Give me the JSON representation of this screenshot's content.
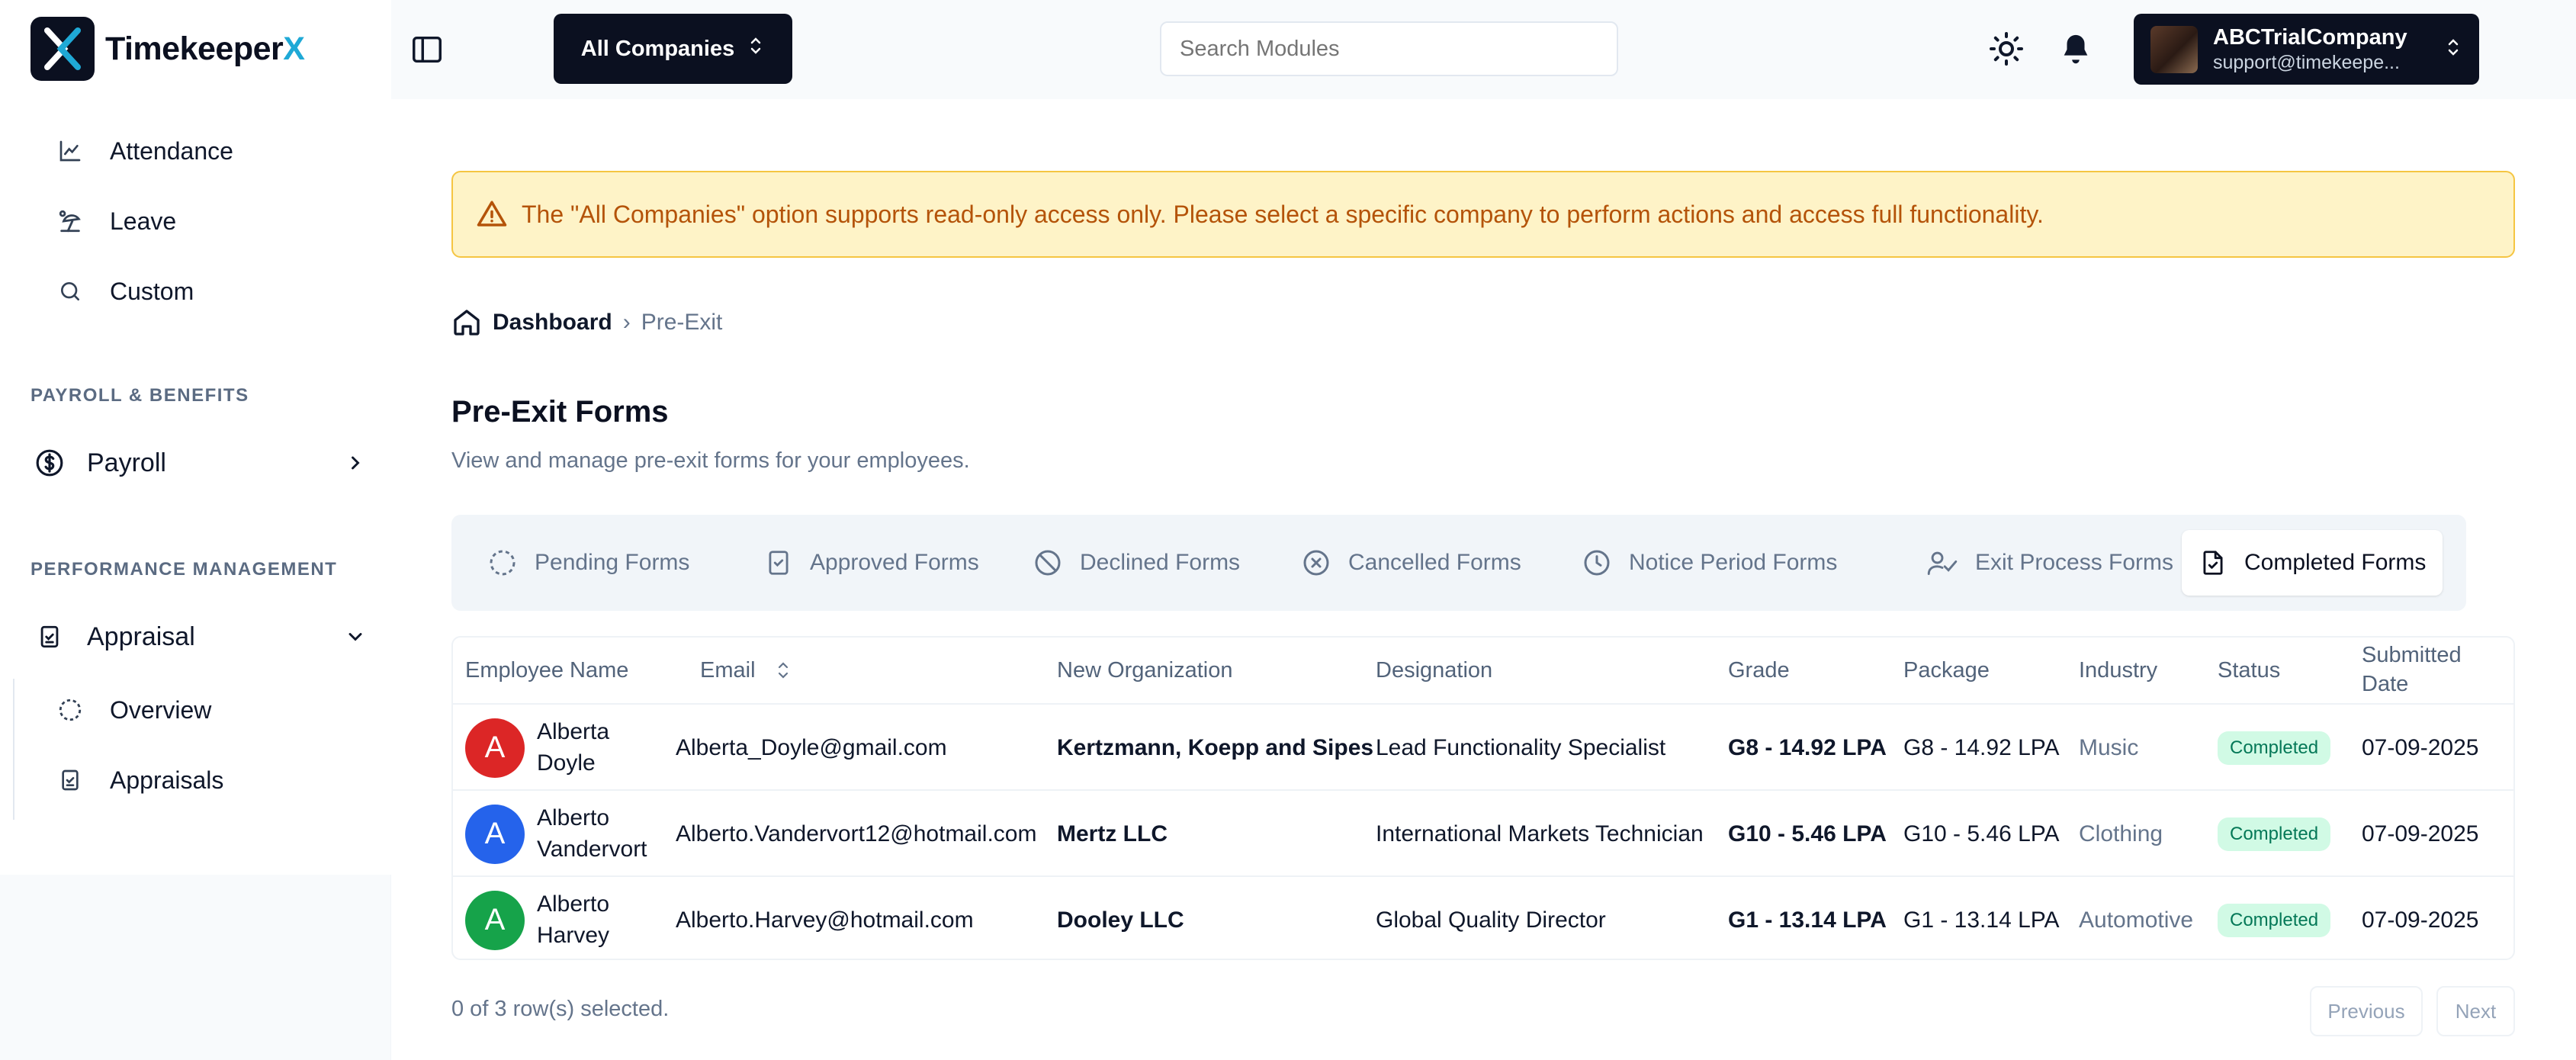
{
  "app": {
    "name_main": "Timekeeper",
    "name_accent": "X",
    "accent_color": "#1fa9d6"
  },
  "sidebar": {
    "items_top": [
      {
        "label": "Attendance",
        "icon": "line-chart-icon"
      },
      {
        "label": "Leave",
        "icon": "beach-umbrella-icon"
      },
      {
        "label": "Custom",
        "icon": "search-icon"
      }
    ],
    "section_payroll": "PAYROLL & BENEFITS",
    "payroll": {
      "label": "Payroll",
      "icon": "dollar-circle-icon"
    },
    "section_performance": "PERFORMANCE MANAGEMENT",
    "appraisal": {
      "label": "Appraisal",
      "icon": "clipboard-check-icon"
    },
    "appraisal_children": [
      {
        "label": "Overview",
        "icon": "dashed-circle-icon"
      },
      {
        "label": "Appraisals",
        "icon": "clipboard-check-icon"
      }
    ]
  },
  "topbar": {
    "company_selector": "All Companies",
    "search_placeholder": "Search Modules",
    "account_name": "ABCTrialCompany",
    "account_email": "support@timekeepe..."
  },
  "alert": {
    "text": "The \"All Companies\" option supports read-only access only. Please select a specific company to perform actions and access full functionality."
  },
  "breadcrumb": {
    "home": "Dashboard",
    "current": "Pre-Exit"
  },
  "page": {
    "title": "Pre-Exit Forms",
    "subtitle": "View and manage pre-exit forms for your employees."
  },
  "tabs": [
    {
      "label": "Pending Forms",
      "icon": "dashed-circle-icon"
    },
    {
      "label": "Approved Forms",
      "icon": "clipboard-check-icon"
    },
    {
      "label": "Declined Forms",
      "icon": "ban-icon"
    },
    {
      "label": "Cancelled Forms",
      "icon": "x-circle-icon"
    },
    {
      "label": "Notice Period Forms",
      "icon": "clock-icon"
    },
    {
      "label": "Exit Process Forms",
      "icon": "user-check-icon"
    },
    {
      "label": "Completed Forms",
      "icon": "file-check-icon",
      "active": true
    }
  ],
  "table": {
    "headers": {
      "name": "Employee Name",
      "email": "Email",
      "org": "New Organization",
      "designation": "Designation",
      "grade": "Grade",
      "package": "Package",
      "industry": "Industry",
      "status": "Status",
      "date_line1": "Submitted",
      "date_line2": "Date"
    },
    "rows": [
      {
        "initial": "A",
        "avatar_color": "#dc2626",
        "first": "Alberta",
        "last": "Doyle",
        "email": "Alberta_Doyle@gmail.com",
        "org": "Kertzmann, Koepp and Sipes",
        "designation": "Lead Functionality Specialist",
        "grade": "G8 - 14.92 LPA",
        "package": "G8 - 14.92 LPA",
        "industry": "Music",
        "status": "Completed",
        "date": "07-09-2025"
      },
      {
        "initial": "A",
        "avatar_color": "#2563eb",
        "first": "Alberto",
        "last": "Vandervort",
        "email": "Alberto.Vandervort12@hotmail.com",
        "org": "Mertz LLC",
        "designation": "International Markets Technician",
        "grade": "G10 - 5.46 LPA",
        "package": "G10 - 5.46 LPA",
        "industry": "Clothing",
        "status": "Completed",
        "date": "07-09-2025"
      },
      {
        "initial": "A",
        "avatar_color": "#16a34a",
        "first": "Alberto",
        "last": "Harvey",
        "email": "Alberto.Harvey@hotmail.com",
        "org": "Dooley LLC",
        "designation": "Global Quality Director",
        "grade": "G1 - 13.14 LPA",
        "package": "G1 - 13.14 LPA",
        "industry": "Automotive",
        "status": "Completed",
        "date": "07-09-2025"
      }
    ]
  },
  "footer": {
    "selection": "0 of 3 row(s) selected.",
    "previous": "Previous",
    "next": "Next"
  }
}
